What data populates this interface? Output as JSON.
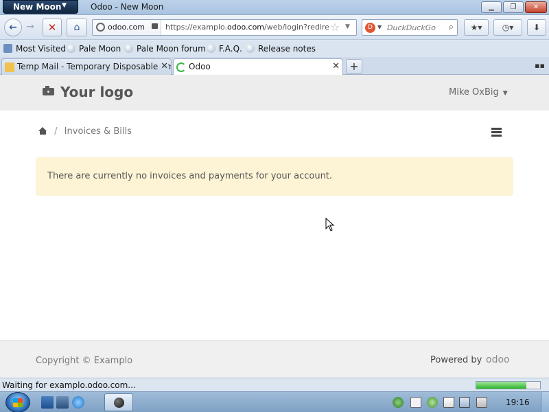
{
  "browser": {
    "app_button": "New Moon",
    "window_title": "Odoo - New Moon",
    "identity": "odoo.com",
    "url_prefix": "https://examplo.",
    "url_domain": "odoo.com",
    "url_rest": "/web/login?redire",
    "search_placeholder": "DuckDuckGo",
    "bookmarks": [
      {
        "label": "Most Visited",
        "icon": "search-icon"
      },
      {
        "label": "Pale Moon",
        "icon": "pale-moon-icon"
      },
      {
        "label": "Pale Moon forum",
        "icon": "pale-moon-icon"
      },
      {
        "label": "F.A.Q.",
        "icon": "pale-moon-icon"
      },
      {
        "label": "Release notes",
        "icon": "pale-moon-icon"
      }
    ],
    "tabs": [
      {
        "label": "Temp Mail - Temporary Disposable Em",
        "icon": "mail-icon",
        "active": false
      },
      {
        "label": "Odoo",
        "icon": "loading-spinner-icon",
        "active": true
      }
    ],
    "status_text": "Waiting for examplo.odoo.com...",
    "loading_progress": 0.78
  },
  "page": {
    "logo_text": "Your logo",
    "user_name": "Mike OxBig",
    "breadcrumb_current": "Invoices & Bills",
    "breadcrumb_separator": "/",
    "alert_message": "There are currently no invoices and payments for your account.",
    "footer_copyright": "Copyright © Examplo",
    "footer_powered": "Powered by",
    "footer_brand": "odoo"
  },
  "taskbar": {
    "clock": "19:16"
  },
  "colors": {
    "alert_bg": "#fdf3d5",
    "header_bg": "#ededed",
    "footer_bg": "#f0f0f0",
    "progress": "#2fb52a"
  }
}
